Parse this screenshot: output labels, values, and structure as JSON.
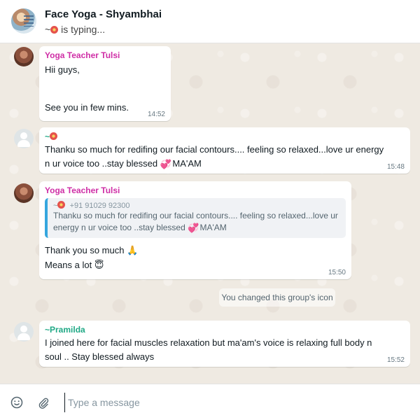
{
  "header": {
    "title": "Face Yoga  - Shyambhai",
    "typing_text": "is typing..."
  },
  "messages": [
    {
      "sender": "Yoga Teacher Tulsi",
      "line1": "Hii guys,",
      "line2": "See you in few mins.",
      "time": "14:52"
    },
    {
      "sender_prefix": "~",
      "line1": "Thanku so much for redifing our facial contours.... feeling so relaxed...love ur energy",
      "line2_start": "n ur voice too ..stay blessed",
      "line2_end": "MA'AM",
      "time": "15:48"
    },
    {
      "sender": "Yoga Teacher Tulsi",
      "quote_prefix": "~",
      "quote_phone": "+91 91029 92300",
      "quote_line1": "Thanku so much for redifing our facial contours.... feeling so relaxed...love ur",
      "quote_line2_start": "energy n ur voice too ..stay blessed",
      "quote_line2_end": "MA'AM",
      "line1": "Thank you so much",
      "line2": "Means a lot",
      "time": "15:50"
    },
    {
      "sender": "~Pramilda",
      "line1": "I joined here for facial muscles relaxation but ma'am's voice is relaxing full body n",
      "line2": "soul .. Stay blessed always",
      "time": "15:52"
    }
  ],
  "system_message": "You changed this group's icon",
  "compose": {
    "placeholder": "Type a message"
  },
  "icons": {
    "emoji": "smiley-icon",
    "attach": "paperclip-icon",
    "pray": "🙏",
    "smile": "😇",
    "heart": "💞"
  },
  "colors": {
    "sender_pink": "#cf2ea6",
    "sender_green": "#1fa885",
    "quote_bar": "#35a6de",
    "chat_bg": "#efeae2"
  }
}
